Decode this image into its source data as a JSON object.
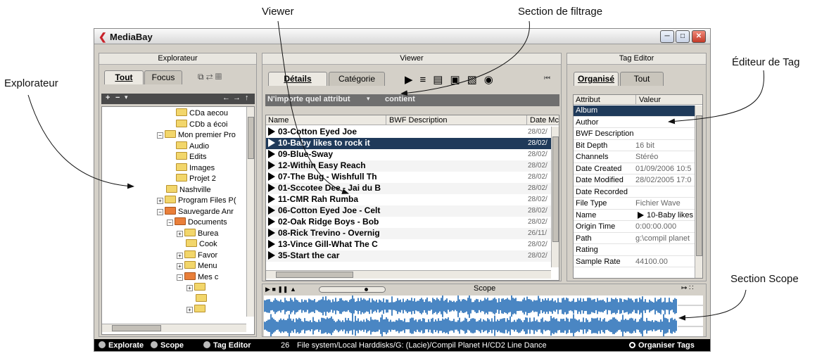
{
  "callouts": {
    "viewer": "Viewer",
    "filter": "Section de filtrage",
    "explorateur": "Explorateur",
    "tag_editor": "Éditeur de Tag",
    "scope": "Section Scope"
  },
  "window": {
    "title": "MediaBay"
  },
  "explorer": {
    "header": "Explorateur",
    "tabs": [
      "Tout",
      "Focus"
    ],
    "tree": [
      {
        "label": "CDa aecou",
        "indent": 5,
        "pm": "",
        "color": "yellow"
      },
      {
        "label": "CDb a écoi",
        "indent": 5,
        "pm": "",
        "color": "yellow"
      },
      {
        "label": "Mon premier Pro",
        "indent": 4,
        "pm": "-",
        "color": "yellow"
      },
      {
        "label": "Audio",
        "indent": 5,
        "pm": "",
        "color": "yellow"
      },
      {
        "label": "Edits",
        "indent": 5,
        "pm": "",
        "color": "yellow"
      },
      {
        "label": "Images",
        "indent": 5,
        "pm": "",
        "color": "yellow"
      },
      {
        "label": "Projet 2",
        "indent": 5,
        "pm": "",
        "color": "yellow"
      },
      {
        "label": "Nashville",
        "indent": 4,
        "pm": "",
        "color": "yellow"
      },
      {
        "label": "Program Files P(",
        "indent": 4,
        "pm": "+",
        "color": "yellow"
      },
      {
        "label": "Sauvegarde Anr",
        "indent": 4,
        "pm": "-",
        "color": "red"
      },
      {
        "label": "Documents",
        "indent": 5,
        "pm": "-",
        "color": "red"
      },
      {
        "label": "Burea",
        "indent": 6,
        "pm": "+",
        "color": "yellow"
      },
      {
        "label": "Cook",
        "indent": 6,
        "pm": "",
        "color": "yellow"
      },
      {
        "label": "Favor",
        "indent": 6,
        "pm": "+",
        "color": "yellow"
      },
      {
        "label": "Menu",
        "indent": 6,
        "pm": "+",
        "color": "yellow"
      },
      {
        "label": "Mes c",
        "indent": 6,
        "pm": "-",
        "color": "red"
      },
      {
        "label": "",
        "indent": 7,
        "pm": "+",
        "color": "yellow"
      },
      {
        "label": "",
        "indent": 7,
        "pm": "",
        "color": "yellow"
      },
      {
        "label": "",
        "indent": 7,
        "pm": "+",
        "color": "yellow"
      }
    ]
  },
  "viewer": {
    "header": "Viewer",
    "tabs": [
      "Détails",
      "Catégorie"
    ],
    "filter_attr": "N'importe quel attribut",
    "filter_op": "contient",
    "columns": [
      "Name",
      "BWF Description",
      "Date Mc"
    ],
    "rows": [
      {
        "name": "03-Cotton Eyed Joe",
        "date": "28/02/"
      },
      {
        "name": "10-Baby likes to rock it",
        "date": "28/02/",
        "selected": true
      },
      {
        "name": "09-Blue-Sway",
        "date": "28/02/"
      },
      {
        "name": "12-Within Easy Reach",
        "date": "28/02/"
      },
      {
        "name": "07-The Bug - Wishfull Th",
        "date": "28/02/"
      },
      {
        "name": "01-Sccotee Dee - Jai du B",
        "date": "28/02/"
      },
      {
        "name": "11-CMR Rah Rumba",
        "date": "28/02/"
      },
      {
        "name": "06-Cotton Eyed Joe - Celt",
        "date": "28/02/"
      },
      {
        "name": "02-Oak Ridge Boys - Bob",
        "date": "28/02/"
      },
      {
        "name": "08-Rick Trevino - Overnig",
        "date": "26/11/"
      },
      {
        "name": "13-Vince Gill-What The C",
        "date": "28/02/"
      },
      {
        "name": "35-Start the car",
        "date": "28/02/"
      }
    ]
  },
  "tag_editor": {
    "header": "Tag Editor",
    "tabs": [
      "Organisé",
      "Tout"
    ],
    "columns": [
      "Attribut",
      "Valeur"
    ],
    "rows": [
      {
        "attr": "Album",
        "val": "",
        "selected": true
      },
      {
        "attr": "Author",
        "val": ""
      },
      {
        "attr": "BWF Description",
        "val": ""
      },
      {
        "attr": "Bit Depth",
        "val": "16 bit"
      },
      {
        "attr": "Channels",
        "val": "Stéréo"
      },
      {
        "attr": "Date Created",
        "val": "01/09/2006 10:5"
      },
      {
        "attr": "Date Modified",
        "val": "28/02/2005 17:0"
      },
      {
        "attr": "Date Recorded",
        "val": ""
      },
      {
        "attr": "File Type",
        "val": "Fichier Wave"
      },
      {
        "attr": "Name",
        "val": "10-Baby likes",
        "icon": "play-icon"
      },
      {
        "attr": "Origin Time",
        "val": "0:00:00.000"
      },
      {
        "attr": "Path",
        "val": "g:\\compil planet"
      },
      {
        "attr": "Rating",
        "val": ""
      },
      {
        "attr": "Sample Rate",
        "val": "44100.00"
      }
    ]
  },
  "scope": {
    "label": "Scope"
  },
  "status": {
    "items": [
      "Explorate",
      "Scope",
      "Tag Editor"
    ],
    "count": "26",
    "path": "File system/Local Harddisks/G: (Lacie)/Compil Planet H/CD2 Line Dance",
    "right": "Organiser Tags"
  },
  "colors": {
    "selection": "#1f3a5a",
    "waveform": "#4a86c3",
    "logo": "#c8222a"
  }
}
